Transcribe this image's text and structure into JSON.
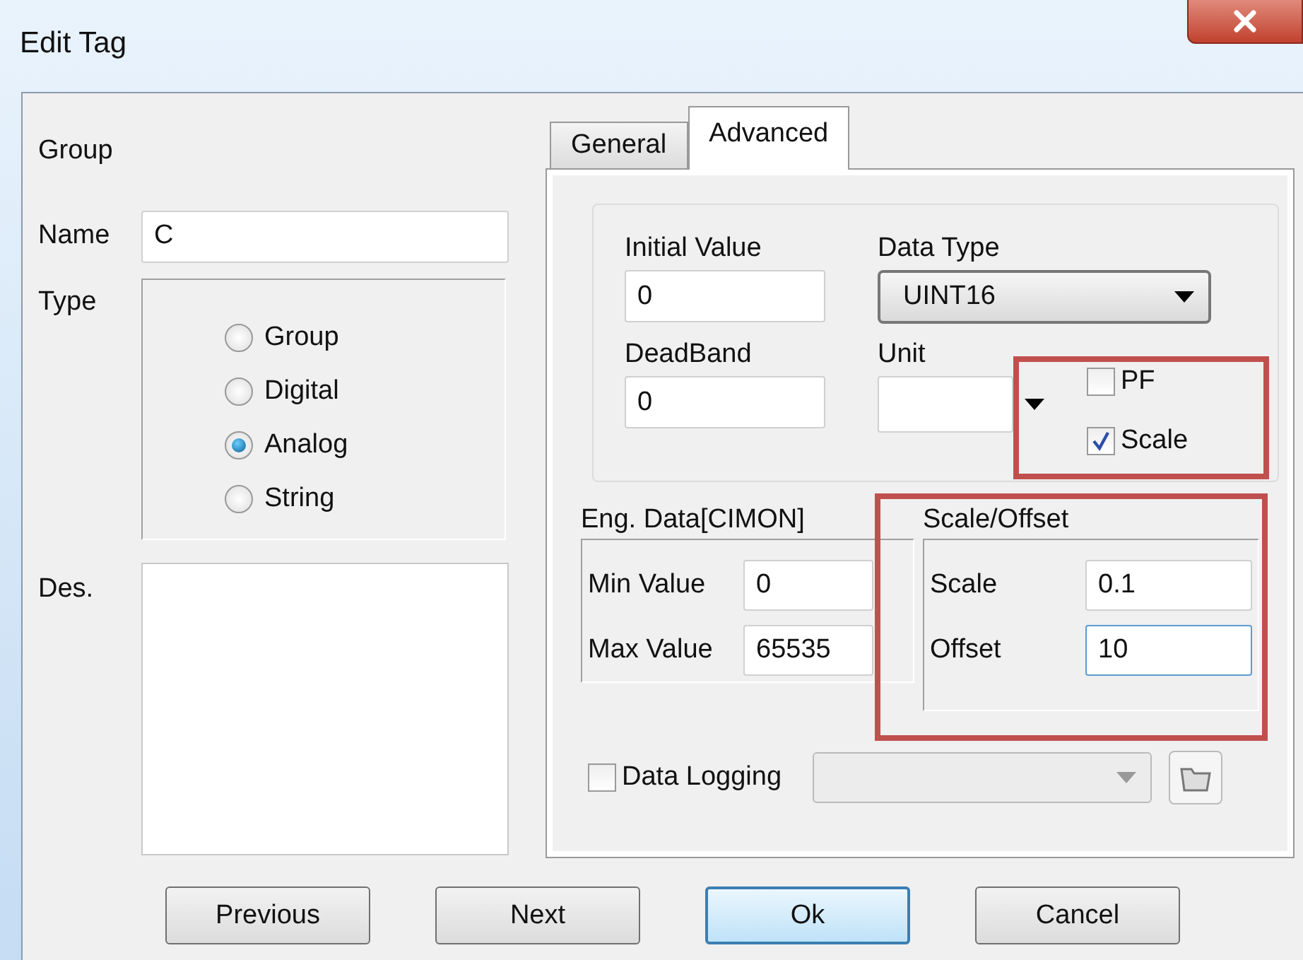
{
  "window": {
    "title": "Edit Tag"
  },
  "left": {
    "group_label": "Group",
    "name_label": "Name",
    "name_value": "C",
    "type_label": "Type",
    "des_label": "Des.",
    "type_options": [
      {
        "label": "Group",
        "selected": false
      },
      {
        "label": "Digital",
        "selected": false
      },
      {
        "label": "Analog",
        "selected": true
      },
      {
        "label": "String",
        "selected": false
      }
    ]
  },
  "tabs": [
    {
      "label": "General",
      "selected": false
    },
    {
      "label": "Advanced",
      "selected": true
    }
  ],
  "advanced": {
    "initial_value": {
      "label": "Initial Value",
      "value": "0"
    },
    "data_type": {
      "label": "Data Type",
      "value": "UINT16"
    },
    "deadband": {
      "label": "DeadBand",
      "value": "0"
    },
    "unit": {
      "label": "Unit"
    },
    "options": {
      "highlighted": true,
      "items": [
        {
          "label": "PF",
          "checked": false
        },
        {
          "label": "Scale",
          "checked": true
        }
      ]
    },
    "eng_data": {
      "title": "Eng. Data[CIMON]",
      "fields": [
        {
          "label": "Min Value",
          "value": "0"
        },
        {
          "label": "Max Value",
          "value": "65535"
        }
      ]
    },
    "scale_offset": {
      "title": "Scale/Offset",
      "highlighted": true,
      "fields": [
        {
          "label": "Scale",
          "value": "0.1",
          "focused": false
        },
        {
          "label": "Offset",
          "value": "10",
          "focused": true
        }
      ]
    },
    "data_logging": {
      "label": "Data Logging",
      "checked": false
    }
  },
  "buttons": [
    {
      "label": "Previous",
      "default": false
    },
    {
      "label": "Next",
      "default": false
    },
    {
      "label": "Ok",
      "default": true
    },
    {
      "label": "Cancel",
      "default": false
    }
  ]
}
